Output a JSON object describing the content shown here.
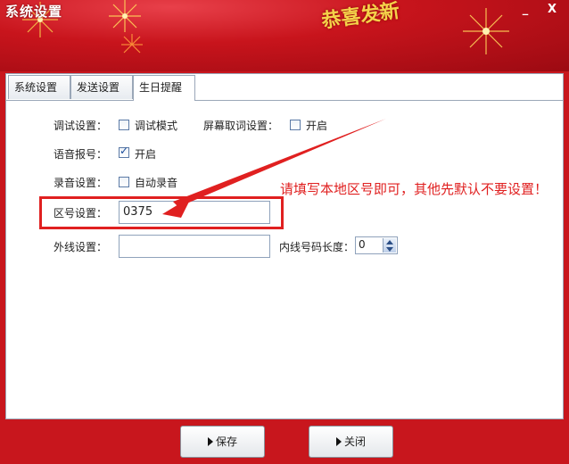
{
  "window": {
    "title": "系统设置",
    "minimize_glyph": "_",
    "close_glyph": "X",
    "blessing": "恭喜发新"
  },
  "tabs": [
    {
      "label": "系统设置",
      "active": false
    },
    {
      "label": "发送设置",
      "active": false
    },
    {
      "label": "生日提醒",
      "active": true
    }
  ],
  "form": {
    "debug_label": "调试设置：",
    "debug_mode_label": "调试模式",
    "debug_mode_checked": false,
    "screen_capture_label": "屏幕取词设置：",
    "screen_capture_option": "开启",
    "screen_capture_checked": false,
    "voice_label": "语音报号：",
    "voice_option": "开启",
    "voice_checked": true,
    "record_label": "录音设置：",
    "record_option": "自动录音",
    "record_checked": false,
    "area_code_label": "区号设置：",
    "area_code_value": "0375",
    "outside_line_label": "外线设置：",
    "outside_line_value": "",
    "internal_length_label": "内线号码长度：",
    "internal_length_value": "0"
  },
  "annotation": {
    "note": "请填写本地区号即可，其他先默认不要设置！",
    "color": "#e02020"
  },
  "buttons": {
    "save": "保存",
    "close": "关闭"
  }
}
